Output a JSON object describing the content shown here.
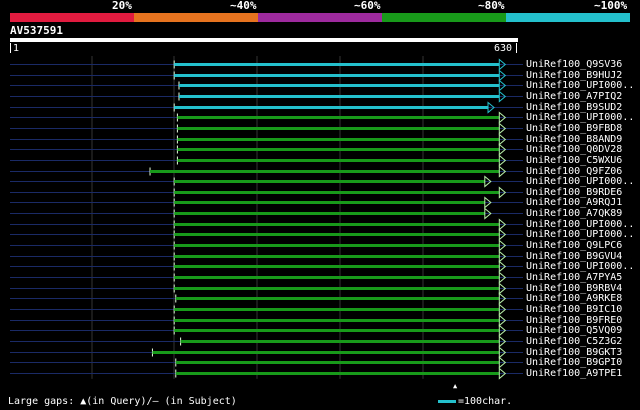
{
  "thresholds": [
    {
      "label": "20%",
      "color": "#e11b3f"
    },
    {
      "label": "~40%",
      "color": "#e6731f"
    },
    {
      "label": "~60%",
      "color": "#9e2a9e"
    },
    {
      "label": "~80%",
      "color": "#189a1a"
    },
    {
      "label": "~100%",
      "color": "#24c0cc"
    }
  ],
  "query": {
    "name": "AV537591",
    "start": "1",
    "end": "630",
    "length": 630
  },
  "colors": {
    "bg": "#000000",
    "cyan": "#24c0cc",
    "green": "#189a1a",
    "guide": "#1a2a66",
    "grid": "#333333",
    "arrow_fill": "#b8f0a8"
  },
  "hits": [
    {
      "label": "UniRef100_Q9SV36",
      "start": 204,
      "end": 608,
      "tier": "cyan",
      "arrow": true
    },
    {
      "label": "UniRef100_B9HUJ2",
      "start": 204,
      "end": 608,
      "tier": "cyan",
      "arrow": true
    },
    {
      "label": "UniRef100_UPI000..",
      "start": 210,
      "end": 608,
      "tier": "cyan",
      "arrow": true
    },
    {
      "label": "UniRef100_A7PIQ2",
      "start": 210,
      "end": 608,
      "tier": "cyan",
      "arrow": true
    },
    {
      "label": "UniRef100_B9SUD2",
      "start": 204,
      "end": 594,
      "tier": "cyan",
      "arrow": true
    },
    {
      "label": "UniRef100_UPI000..",
      "start": 208,
      "end": 608,
      "tier": "green",
      "arrow": true
    },
    {
      "label": "UniRef100_B9FBD8",
      "start": 208,
      "end": 608,
      "tier": "green",
      "arrow": true
    },
    {
      "label": "UniRef100_B8AND9",
      "start": 208,
      "end": 608,
      "tier": "green",
      "arrow": true
    },
    {
      "label": "UniRef100_Q0DV28",
      "start": 208,
      "end": 608,
      "tier": "green",
      "arrow": true
    },
    {
      "label": "UniRef100_C5WXU6",
      "start": 208,
      "end": 608,
      "tier": "green",
      "arrow": true
    },
    {
      "label": "UniRef100_Q9FZ06",
      "start": 174,
      "end": 608,
      "tier": "green",
      "arrow": true
    },
    {
      "label": "UniRef100_UPI000..",
      "start": 204,
      "end": 590,
      "tier": "green",
      "arrow": true
    },
    {
      "label": "UniRef100_B9RDE6",
      "start": 204,
      "end": 608,
      "tier": "green",
      "arrow": true
    },
    {
      "label": "UniRef100_A9RQJ1",
      "start": 204,
      "end": 590,
      "tier": "green",
      "arrow": true
    },
    {
      "label": "UniRef100_A7QK89",
      "start": 204,
      "end": 590,
      "tier": "green",
      "arrow": true
    },
    {
      "label": "UniRef100_UPI000..",
      "start": 204,
      "end": 608,
      "tier": "green",
      "arrow": true
    },
    {
      "label": "UniRef100_UPI000..",
      "start": 204,
      "end": 608,
      "tier": "green",
      "arrow": true
    },
    {
      "label": "UniRef100_Q9LPC6",
      "start": 204,
      "end": 608,
      "tier": "green",
      "arrow": true
    },
    {
      "label": "UniRef100_B9GVU4",
      "start": 204,
      "end": 608,
      "tier": "green",
      "arrow": true
    },
    {
      "label": "UniRef100_UPI000..",
      "start": 204,
      "end": 608,
      "tier": "green",
      "arrow": true
    },
    {
      "label": "UniRef100_A7PYA5",
      "start": 204,
      "end": 608,
      "tier": "green",
      "arrow": true
    },
    {
      "label": "UniRef100_B9RBV4",
      "start": 204,
      "end": 608,
      "tier": "green",
      "arrow": true
    },
    {
      "label": "UniRef100_A9RKE8",
      "start": 206,
      "end": 608,
      "tier": "green",
      "arrow": true
    },
    {
      "label": "UniRef100_B9IC10",
      "start": 204,
      "end": 608,
      "tier": "green",
      "arrow": true
    },
    {
      "label": "UniRef100_B9FRE0",
      "start": 204,
      "end": 608,
      "tier": "green",
      "arrow": true
    },
    {
      "label": "UniRef100_Q5VQ09",
      "start": 204,
      "end": 608,
      "tier": "green",
      "arrow": true
    },
    {
      "label": "UniRef100_C5Z3G2",
      "start": 212,
      "end": 608,
      "tier": "green",
      "arrow": true
    },
    {
      "label": "UniRef100_B9GKT3",
      "start": 177,
      "end": 608,
      "tier": "green",
      "arrow": true
    },
    {
      "label": "UniRef100_B9GPI0",
      "start": 206,
      "end": 608,
      "tier": "green",
      "arrow": true
    },
    {
      "label": "UniRef100_A9TPE1",
      "start": 206,
      "end": 608,
      "tier": "green",
      "arrow": true
    }
  ],
  "footer": {
    "gaps_text": "Large gaps: ▲(in Query)/– (in Subject)",
    "scale_text": "=100char."
  }
}
